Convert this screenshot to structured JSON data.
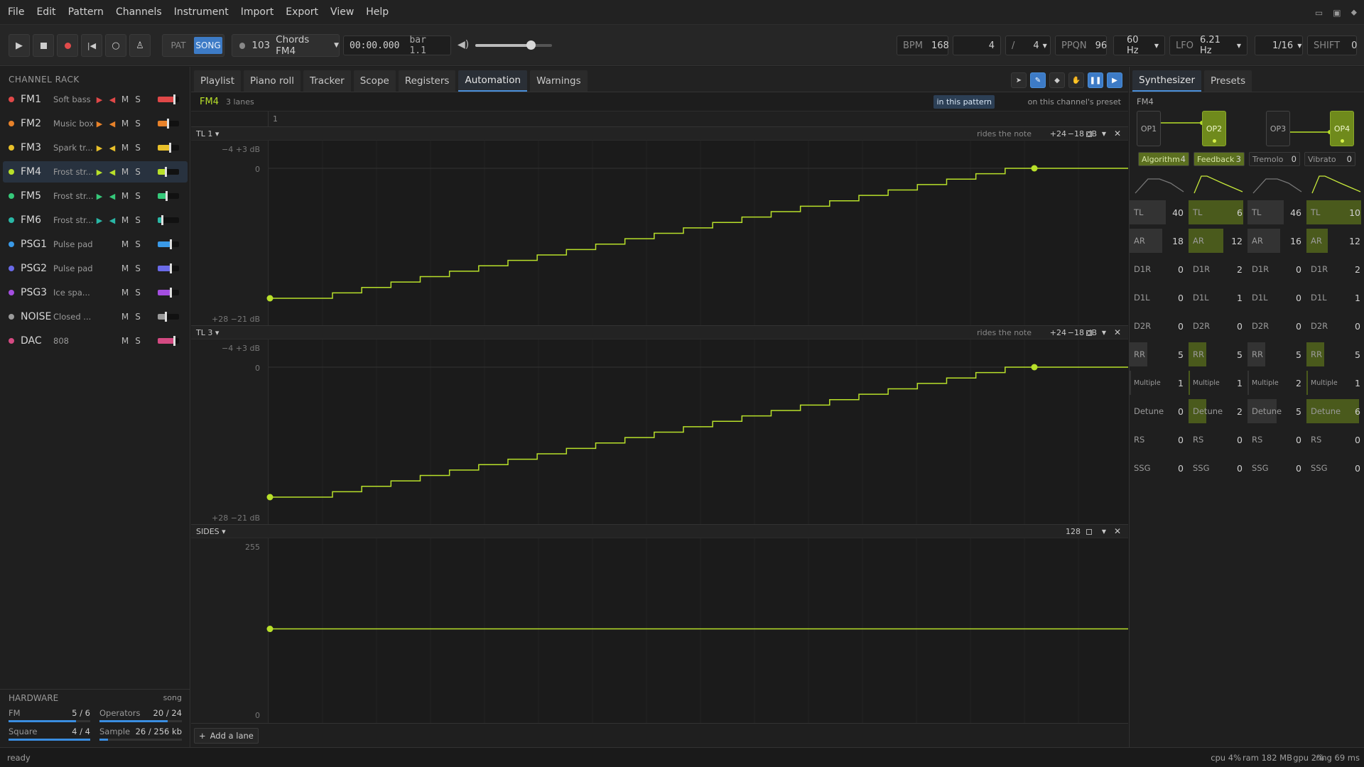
{
  "menu": [
    "File",
    "Edit",
    "Pattern",
    "Channels",
    "Instrument",
    "Import",
    "Export",
    "View",
    "Help"
  ],
  "transport": {
    "mode_pat": "PAT",
    "mode_song": "SONG",
    "pattern_number": "103",
    "pattern_name": "Chords FM4",
    "time": "00:00.000",
    "bar": "bar 1.1",
    "volume": 0.72,
    "bpm_label": "BPM",
    "bpm": "168",
    "beats": "4",
    "slash": "/",
    "denominator": "4",
    "ppqn_label": "PPQN",
    "ppqn": "96",
    "hz": "60 Hz",
    "lfo_label": "LFO",
    "lfo": "6.21 Hz",
    "grid": "1/16",
    "shift_label": "SHIFT",
    "shift": "0"
  },
  "channel_rack": {
    "title": "CHANNEL RACK",
    "channels": [
      {
        "name": "FM1",
        "desc": "Soft bass",
        "color": "#e04848",
        "level": 0.75
      },
      {
        "name": "FM2",
        "desc": "Music box",
        "color": "#e8822a",
        "level": 0.45
      },
      {
        "name": "FM3",
        "desc": "Spark tr...",
        "color": "#e8c02a",
        "level": 0.55
      },
      {
        "name": "FM4",
        "desc": "Frost str...",
        "color": "#b8e02a",
        "level": 0.35
      },
      {
        "name": "FM5",
        "desc": "Frost str...",
        "color": "#36c97a",
        "level": 0.4
      },
      {
        "name": "FM6",
        "desc": "Frost str...",
        "color": "#2ab7a6",
        "level": 0.2
      },
      {
        "name": "PSG1",
        "desc": "Pulse pad",
        "color": "#3a9ae8",
        "level": 0.6
      },
      {
        "name": "PSG2",
        "desc": "Pulse pad",
        "color": "#6a6ae8",
        "level": 0.6
      },
      {
        "name": "PSG3",
        "desc": "Ice spa...",
        "color": "#a44ee0",
        "level": 0.6
      },
      {
        "name": "NOISE",
        "desc": "Closed ...",
        "color": "#9a9a9a",
        "level": 0.35
      },
      {
        "name": "DAC",
        "desc": "808",
        "color": "#d44a82",
        "level": 0.75
      }
    ],
    "mute_label": "M",
    "solo_label": "S"
  },
  "hardware": {
    "title": "HARDWARE",
    "scope": "song",
    "fm_label": "FM",
    "fm_value": "5 / 6",
    "fm_frac": 0.83,
    "ops_label": "Operators",
    "ops_value": "20 / 24",
    "ops_frac": 0.83,
    "sq_label": "Square",
    "sq_value": "4 / 4",
    "sq_frac": 1.0,
    "sample_label": "Sample",
    "sample_value": "26 / 256 kb",
    "sample_frac": 0.1
  },
  "tabs": [
    "Playlist",
    "Piano roll",
    "Tracker",
    "Scope",
    "Registers",
    "Automation",
    "Warnings"
  ],
  "active_tab": "Automation",
  "automation": {
    "channel": "FM4",
    "lanes_count": "3 lanes",
    "scope_this": "in this pattern",
    "scope_preset": "on this channel's preset",
    "ruler_bar": "1",
    "lanes": [
      {
        "name": "TL 1 ▾",
        "rides": "rides the note",
        "offset": "+24",
        "db": "−18 dB",
        "top_label": "−4  +3 dB",
        "zero_label": "0",
        "bottom_label": "+28  −21 dB"
      },
      {
        "name": "TL 3 ▾",
        "rides": "rides the note",
        "offset": "+24",
        "db": "−18 dB",
        "top_label": "−4  +3 dB",
        "zero_label": "0",
        "bottom_label": "+28  −21 dB"
      },
      {
        "name": "SIDES ▾",
        "value": "128",
        "top_label": "255",
        "bottom_label": "0"
      }
    ],
    "add_lane": "Add a lane"
  },
  "synth": {
    "tabs": [
      "Synthesizer",
      "Presets"
    ],
    "channel": "FM4",
    "ops": [
      "OP1",
      "OP2",
      "OP3",
      "OP4"
    ],
    "globals": [
      {
        "label": "Algorithm",
        "value": "4"
      },
      {
        "label": "Feedback",
        "value": "3"
      },
      {
        "label": "Tremolo",
        "value": "0"
      },
      {
        "label": "Vibrato",
        "value": "0"
      }
    ],
    "rows": [
      "TL",
      "AR",
      "D1R",
      "D1L",
      "D2R",
      "RR",
      "Multiple",
      "Detune",
      "RS",
      "SSG"
    ],
    "values": [
      [
        "40",
        "18",
        "0",
        "0",
        "0",
        "5",
        "1",
        "0",
        "0",
        "0"
      ],
      [
        "6",
        "12",
        "2",
        "1",
        "0",
        "5",
        "1",
        "2",
        "0",
        "0"
      ],
      [
        "46",
        "16",
        "0",
        "0",
        "0",
        "5",
        "2",
        "5",
        "0",
        "0"
      ],
      [
        "10",
        "12",
        "2",
        "1",
        "0",
        "5",
        "1",
        "6",
        "0",
        "0"
      ]
    ]
  },
  "status": {
    "left": "ready",
    "cpu": "cpu 4%",
    "ram": "ram 182 MB",
    "gpu": "gpu 2%",
    "ring": "ring 69 ms"
  }
}
